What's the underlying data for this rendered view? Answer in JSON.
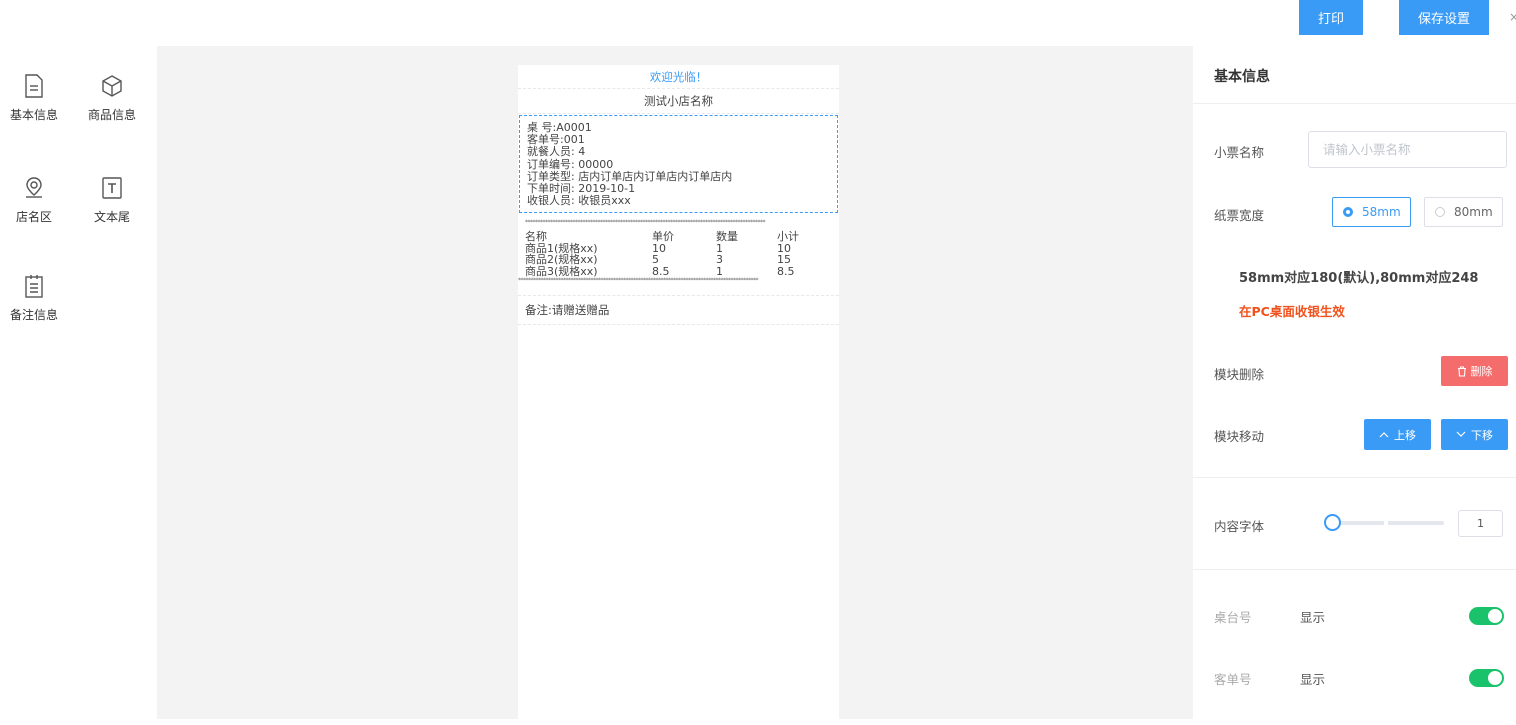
{
  "toolbar": {
    "print_label": "打印",
    "save_label": "保存设置",
    "close_glyph": "×"
  },
  "sidebar": {
    "items": [
      {
        "label": "基本信息",
        "icon": "document-icon"
      },
      {
        "label": "商品信息",
        "icon": "box-icon"
      },
      {
        "label": "店名区",
        "icon": "location-icon"
      },
      {
        "label": "文本尾",
        "icon": "text-icon"
      },
      {
        "label": "备注信息",
        "icon": "clipboard-icon"
      }
    ]
  },
  "receipt": {
    "welcome": "欢迎光临！",
    "shop_name": "测试小店名称",
    "info_lines": [
      "桌 号:A0001",
      "客单号:001",
      "就餐人员: 4",
      "订单编号: 00000",
      "订单类型: 店内订单店内订单店内订单店内",
      "下单时间: 2019-10-1",
      "收银人员: 收银员xxx"
    ],
    "stars": "************************************************************************************************",
    "goods_header": [
      "名称",
      "单价",
      "数量",
      "小计"
    ],
    "goods_rows": [
      [
        "商品1(规格xx)",
        "10",
        "1",
        "10"
      ],
      [
        "商品2(规格xx)",
        "5",
        "3",
        "15"
      ],
      [
        "商品3(规格xx)",
        "8.5",
        "1",
        "8.5"
      ]
    ],
    "note": "备注:请赠送赠品"
  },
  "panel": {
    "title": "基本信息",
    "ticket_name_label": "小票名称",
    "ticket_name_placeholder": "请输入小票名称",
    "ticket_name_value": "",
    "paper_width_label": "纸票宽度",
    "width_options": [
      "58mm",
      "80mm"
    ],
    "width_selected": "58mm",
    "hint_width": "58mm对应180(默认),80mm对应248",
    "hint_pc": "在PC桌面收银生效",
    "module_delete_label": "模块删除",
    "delete_button": "删除",
    "module_move_label": "模块移动",
    "move_up_button": "上移",
    "move_down_button": "下移",
    "font_label": "内容字体",
    "font_value": "1",
    "toggles": [
      {
        "label": "桌台号",
        "state_text": "显示",
        "on": true
      },
      {
        "label": "客单号",
        "state_text": "显示",
        "on": true
      }
    ],
    "accent_color": "#3a9bf7",
    "danger_color": "#f56c6c",
    "success_color": "#19c26b",
    "warning_text_color": "#f0521e"
  }
}
